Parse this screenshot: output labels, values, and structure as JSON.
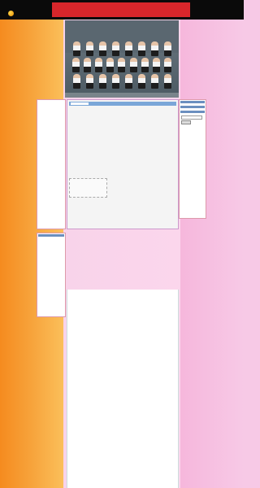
{
  "top": {
    "tiny": "",
    "logo_text": "",
    "banner_text": "",
    "banner_brand": ""
  },
  "photo": {
    "caption": ""
  },
  "left": {
    "title": "",
    "dates1": [],
    "title2": "",
    "dates2": []
  },
  "main": {
    "tab": "",
    "tool": "",
    "links": "",
    "article_title": "",
    "meta1": "",
    "meta2": "",
    "list": [],
    "highlight": "",
    "more": ""
  },
  "right": {
    "section1": [],
    "section2": [],
    "section3": []
  },
  "left2": {
    "items": []
  },
  "comments": {
    "lines": [],
    "bigred1": "",
    "bigred2": "",
    "pink1": "",
    "pink2": ""
  }
}
